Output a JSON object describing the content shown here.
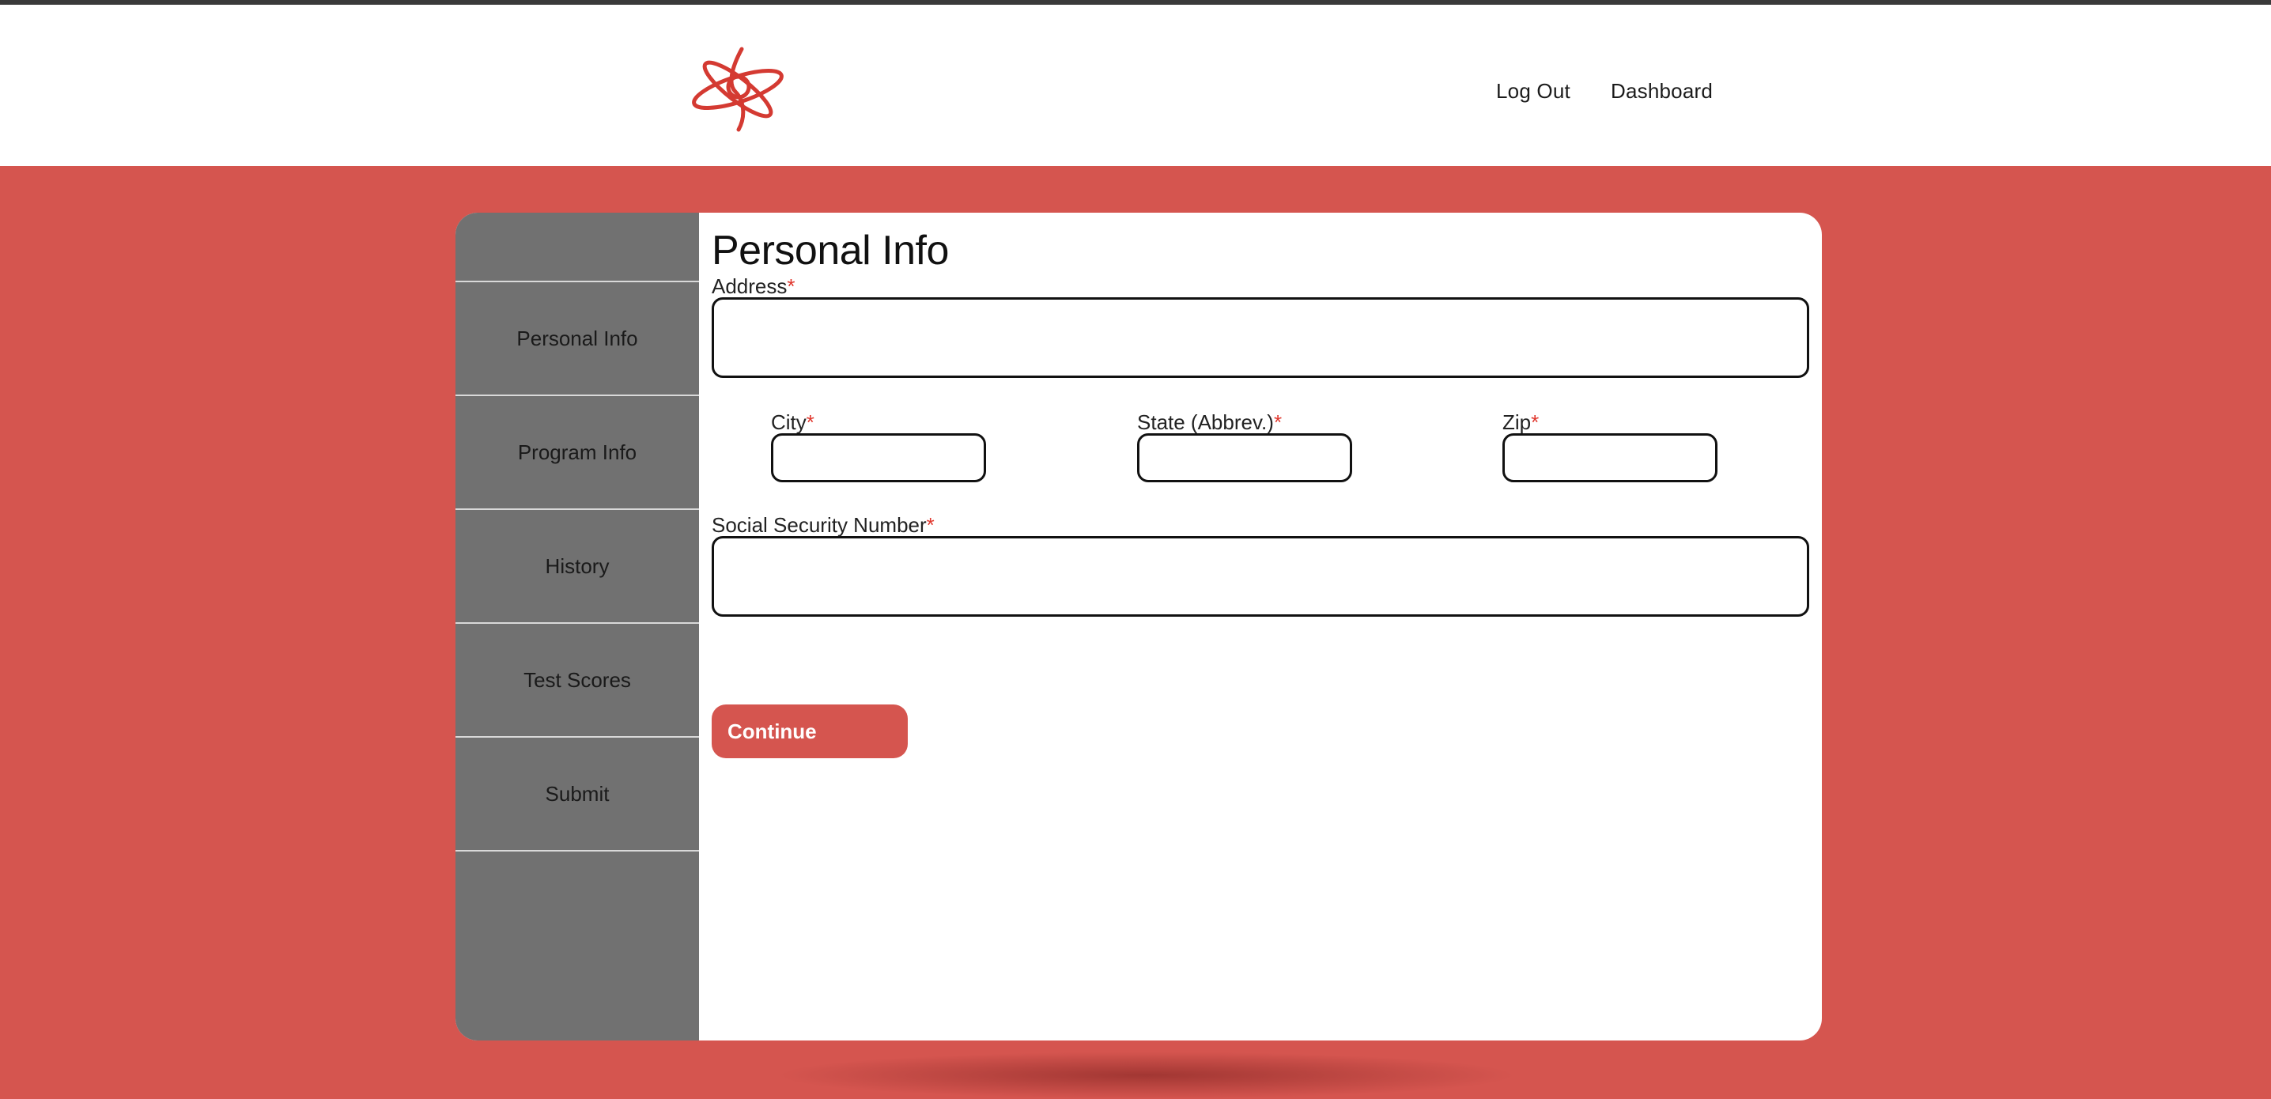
{
  "header": {
    "logo_icon": "atom-logo-icon",
    "nav": {
      "logout_label": "Log Out",
      "dashboard_label": "Dashboard"
    }
  },
  "sidebar": {
    "items": [
      {
        "label": "Personal Info"
      },
      {
        "label": "Program Info"
      },
      {
        "label": "History"
      },
      {
        "label": "Test Scores"
      },
      {
        "label": "Submit"
      }
    ]
  },
  "form": {
    "title": "Personal Info",
    "required_marker": "*",
    "address": {
      "label": "Address",
      "value": "",
      "placeholder": ""
    },
    "city": {
      "label": "City",
      "value": "",
      "placeholder": ""
    },
    "state": {
      "label": "State (Abbrev.)",
      "value": "",
      "placeholder": ""
    },
    "zip": {
      "label": "Zip",
      "value": "",
      "placeholder": ""
    },
    "ssn": {
      "label": "Social Security Number",
      "value": "",
      "placeholder": ""
    },
    "continue_label": "Continue"
  },
  "colors": {
    "accent": "#d5554f",
    "sidebar": "#717171",
    "required": "#e0362c"
  }
}
